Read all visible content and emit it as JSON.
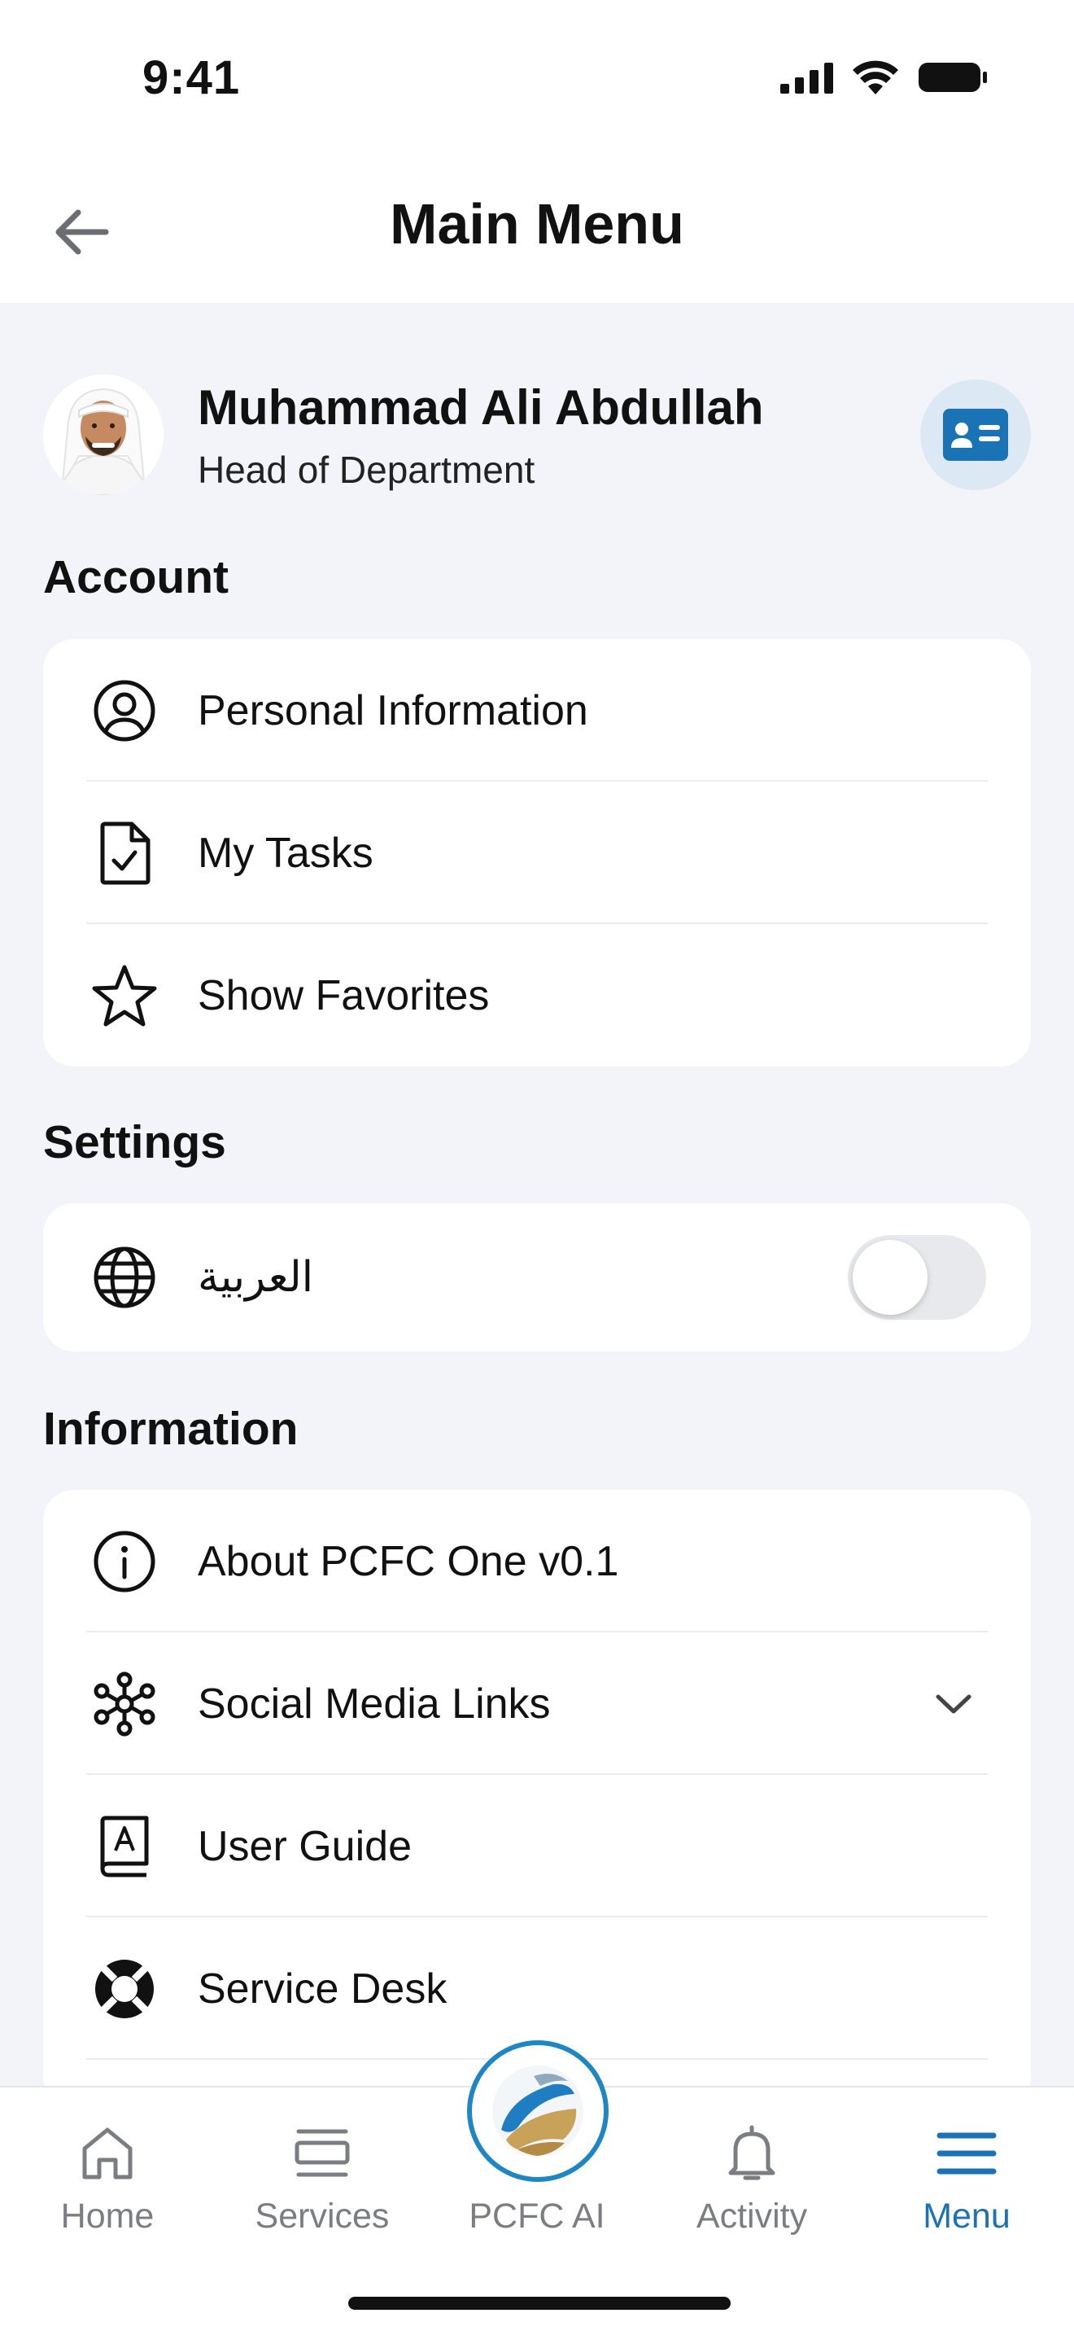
{
  "status": {
    "time": "9:41"
  },
  "header": {
    "title": "Main Menu"
  },
  "profile": {
    "name": "Muhammad Ali Abdullah",
    "role": "Head of Department"
  },
  "sections": {
    "account": {
      "title": "Account",
      "items": [
        {
          "label": "Personal Information",
          "icon": "user-circle-icon"
        },
        {
          "label": "My Tasks",
          "icon": "task-check-icon"
        },
        {
          "label": "Show Favorites",
          "icon": "star-icon"
        }
      ]
    },
    "settings": {
      "title": "Settings",
      "items": [
        {
          "label": "العربية",
          "icon": "globe-icon",
          "toggle": false
        }
      ]
    },
    "information": {
      "title": "Information",
      "items": [
        {
          "label": "About PCFC One v0.1",
          "icon": "info-icon"
        },
        {
          "label": "Social Media Links",
          "icon": "network-icon",
          "expandable": true
        },
        {
          "label": "User Guide",
          "icon": "guide-book-icon"
        },
        {
          "label": "Service Desk",
          "icon": "lifebuoy-icon"
        }
      ]
    }
  },
  "tabbar": {
    "items": [
      {
        "label": "Home",
        "icon": "home-icon",
        "active": false
      },
      {
        "label": "Services",
        "icon": "services-icon",
        "active": false
      },
      {
        "label": "PCFC AI",
        "icon": "ai-globe-icon",
        "active": false
      },
      {
        "label": "Activity",
        "icon": "bell-icon",
        "active": false
      },
      {
        "label": "Menu",
        "icon": "menu-icon",
        "active": true
      }
    ]
  },
  "colors": {
    "accent": "#1a73b4",
    "background": "#f2f4f9",
    "card": "#ffffff",
    "inactive_tab": "#7b7d83"
  }
}
